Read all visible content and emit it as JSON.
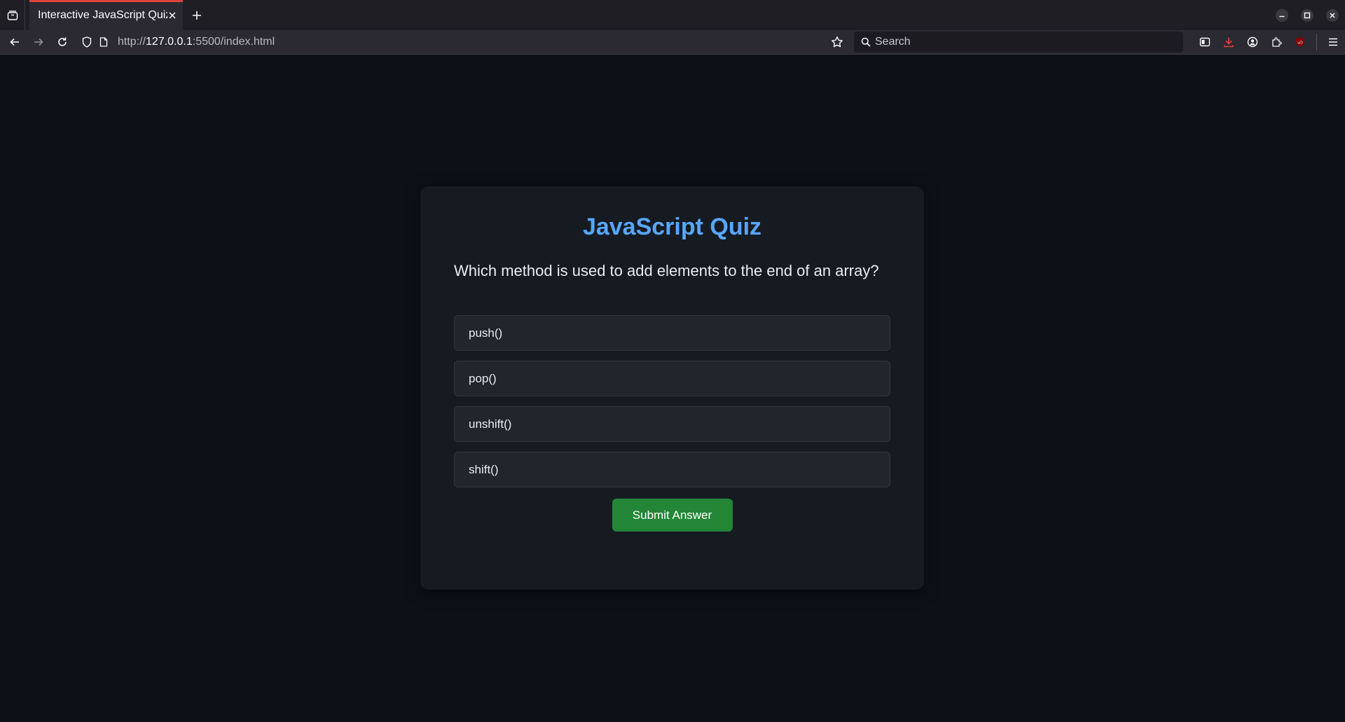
{
  "browser": {
    "tab": {
      "title": "Interactive JavaScript Quiz"
    },
    "url": {
      "scheme": "http://",
      "host": "127.0.0.1",
      "rest": ":5500/index.html"
    },
    "search": {
      "placeholder": "Search"
    }
  },
  "quiz": {
    "title": "JavaScript Quiz",
    "question": "Which method is used to add elements to the end of an array?",
    "options": [
      {
        "label": "push()"
      },
      {
        "label": "pop()"
      },
      {
        "label": "unshift()"
      },
      {
        "label": "shift()"
      }
    ],
    "submit_label": "Submit Answer"
  },
  "colors": {
    "accent": "#58a6ff",
    "submit": "#238636",
    "tab_indicator": "#e0433a"
  }
}
